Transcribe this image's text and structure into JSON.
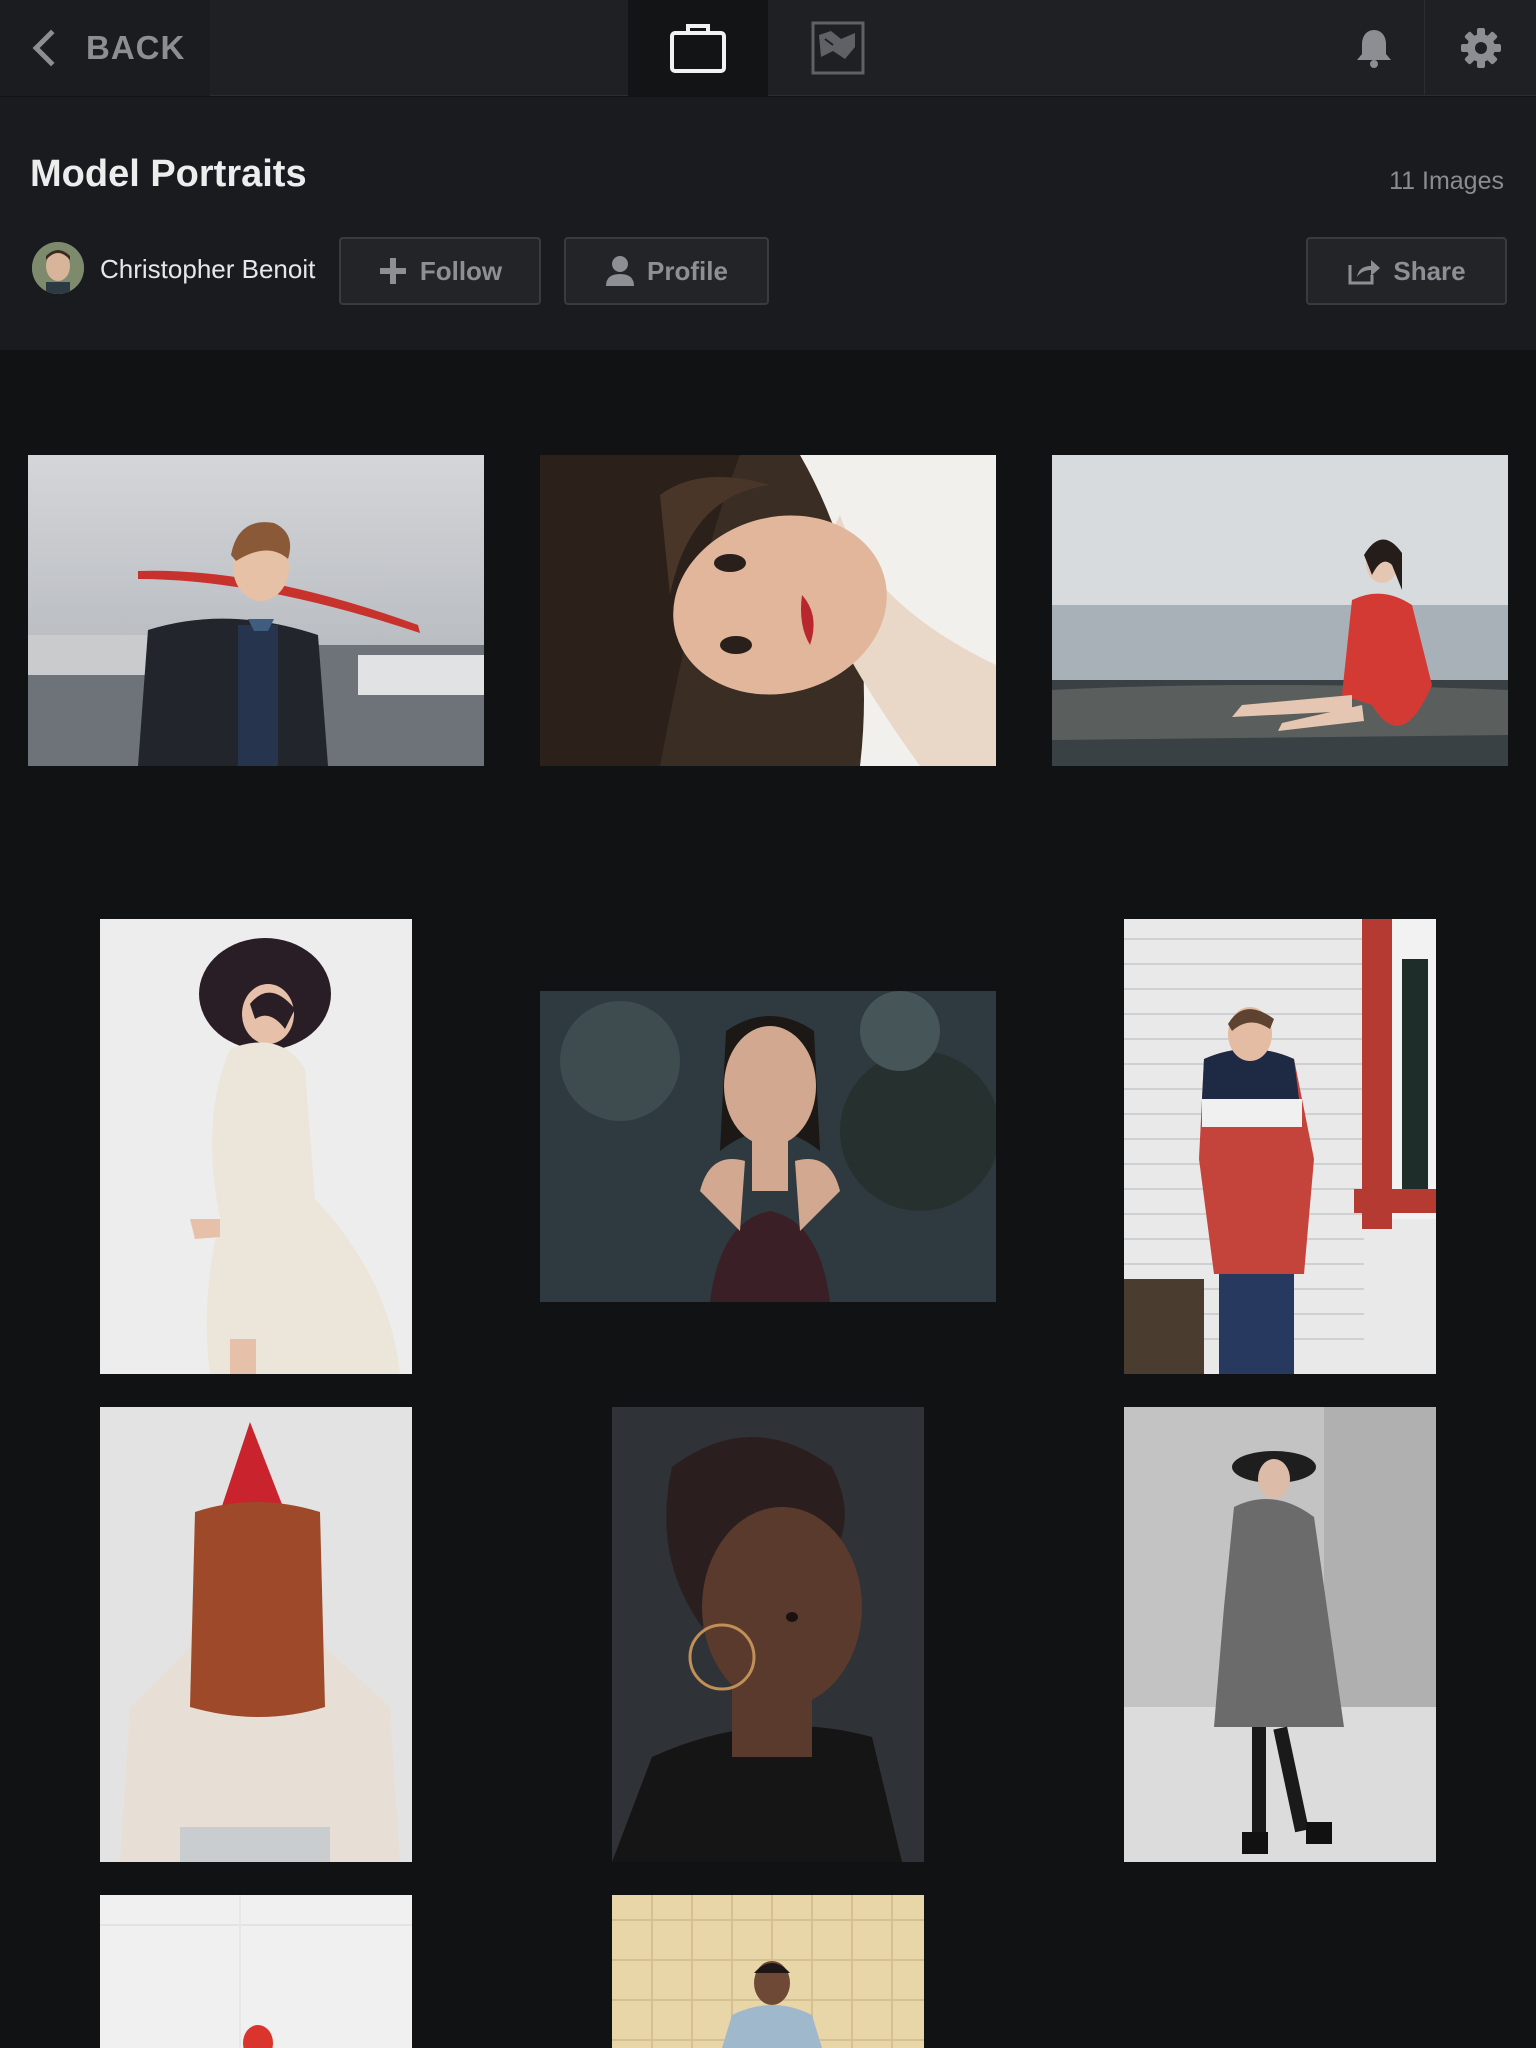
{
  "topbar": {
    "back_label": "BACK",
    "tabs": [
      "portfolio-tab",
      "gallery-tab"
    ],
    "icons": [
      "bell-icon",
      "gear-icon"
    ]
  },
  "collection": {
    "title": "Model Portraits",
    "count_label": "11 Images",
    "author": "Christopher Benoit"
  },
  "actions": {
    "follow_label": "Follow",
    "profile_label": "Profile",
    "share_label": "Share"
  },
  "photos": [
    {
      "id": "boy-red-umbrella"
    },
    {
      "id": "woman-red-lips"
    },
    {
      "id": "woman-red-dress-shore"
    },
    {
      "id": "woman-black-hat-lace-dress"
    },
    {
      "id": "woman-dark-background"
    },
    {
      "id": "boy-stars-sweater"
    },
    {
      "id": "woman-party-hat"
    },
    {
      "id": "woman-hoop-earrings"
    },
    {
      "id": "woman-grey-coat"
    },
    {
      "id": "person-red-beanie"
    },
    {
      "id": "man-denim-vest"
    }
  ],
  "colors": {
    "background": "#111214",
    "topbar": "#1f2023",
    "header": "#1a1b1e",
    "button_border": "#3a3b40",
    "muted_text": "#8c8e94"
  }
}
